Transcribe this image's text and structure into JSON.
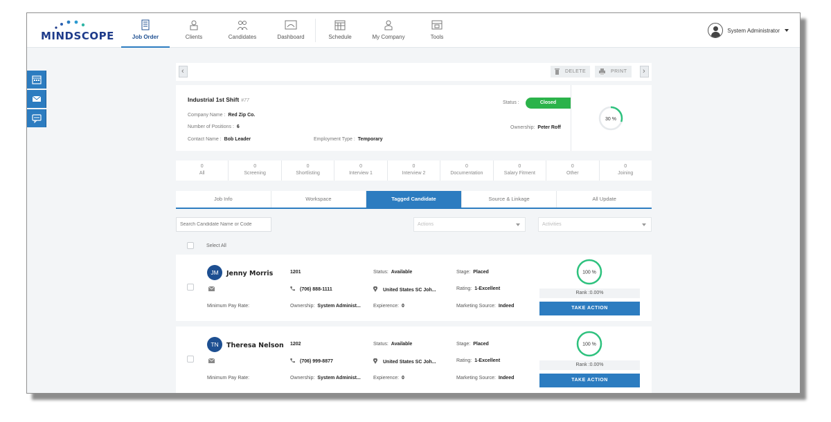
{
  "brand": {
    "logo_text": "MINDSCOPE"
  },
  "nav": {
    "items": [
      {
        "label": "Job Order",
        "icon": "job-order-icon",
        "active": true
      },
      {
        "label": "Clients",
        "icon": "clients-icon"
      },
      {
        "label": "Candidates",
        "icon": "candidates-icon"
      },
      {
        "label": "Dashboard",
        "icon": "dashboard-icon"
      },
      {
        "label": "Schedule",
        "icon": "schedule-icon"
      },
      {
        "label": "My Company",
        "icon": "my-company-icon"
      },
      {
        "label": "Tools",
        "icon": "tools-icon"
      }
    ]
  },
  "user": {
    "name": "System Administrator"
  },
  "side_tabs": [
    "calendar-icon",
    "email-icon",
    "sms-icon"
  ],
  "toolbar": {
    "delete_label": "DELETE",
    "print_label": "PRINT"
  },
  "job": {
    "title": "Industrial 1st Shift",
    "number": "#77",
    "company_label": "Company Name :",
    "company": "Red Zip Co.",
    "positions_label": "Number of Positions :",
    "positions": "6",
    "contact_label": "Contact Name :",
    "contact": "Bob Leader",
    "employment_label": "Employment Type :",
    "employment": "Temporary",
    "status_label": "Status :",
    "status": "Closed",
    "ownership_label": "Ownership:",
    "ownership": "Peter Roff",
    "progress_text": "30 %",
    "progress_value": 0.3
  },
  "stages": [
    {
      "count": "0",
      "label": "All"
    },
    {
      "count": "0",
      "label": "Screening"
    },
    {
      "count": "0",
      "label": "Shortlisting"
    },
    {
      "count": "0",
      "label": "Interview 1"
    },
    {
      "count": "0",
      "label": "Interview 2"
    },
    {
      "count": "0",
      "label": "Documentation"
    },
    {
      "count": "0",
      "label": "Salary Fitment"
    },
    {
      "count": "0",
      "label": "Other"
    },
    {
      "count": "0",
      "label": "Joining"
    }
  ],
  "tabs": [
    {
      "label": "Job Info"
    },
    {
      "label": "Workspace"
    },
    {
      "label": "Tagged Candidate",
      "active": true
    },
    {
      "label": "Source & Linkage"
    },
    {
      "label": "All Update"
    }
  ],
  "filters": {
    "search_placeholder": "Search Candidate Name or Code",
    "actions_placeholder": "Actions",
    "activities_placeholder": "Activities"
  },
  "select_all_label": "Select All",
  "labels": {
    "status": "Status:",
    "stage": "Stage:",
    "rating": "Rating:",
    "min_pay": "Minimum Pay Rate:",
    "ownership": "Ownership:",
    "experience": "Expierence:",
    "marketing": "Marketing Source:",
    "take_action": "TAKE ACTION"
  },
  "candidates": [
    {
      "initials": "JM",
      "name": "Jenny Morris",
      "code": "1201",
      "status": "Available",
      "stage": "Placed",
      "phone": "(706) 888-1111",
      "location": "United States SC Joh...",
      "rating": "1-Excellent",
      "ownership": "System Administ...",
      "experience": "0",
      "marketing": "Indeed",
      "match_text": "100 %",
      "match_value": 1.0,
      "rank": "Rank :0.00%"
    },
    {
      "initials": "TN",
      "name": "Theresa Nelson",
      "code": "1202",
      "status": "Available",
      "stage": "Placed",
      "phone": "(706) 999-8877",
      "location": "United States SC Joh...",
      "rating": "1-Excellent",
      "ownership": "System Administ...",
      "experience": "0",
      "marketing": "Indeed",
      "match_text": "100 %",
      "match_value": 1.0,
      "rank": "Rank :0.00%"
    }
  ],
  "colors": {
    "accent": "#2c7cc0",
    "status_closed": "#2bb34a",
    "ring": "#2ec27e",
    "ring_track": "#e6e9ec"
  }
}
